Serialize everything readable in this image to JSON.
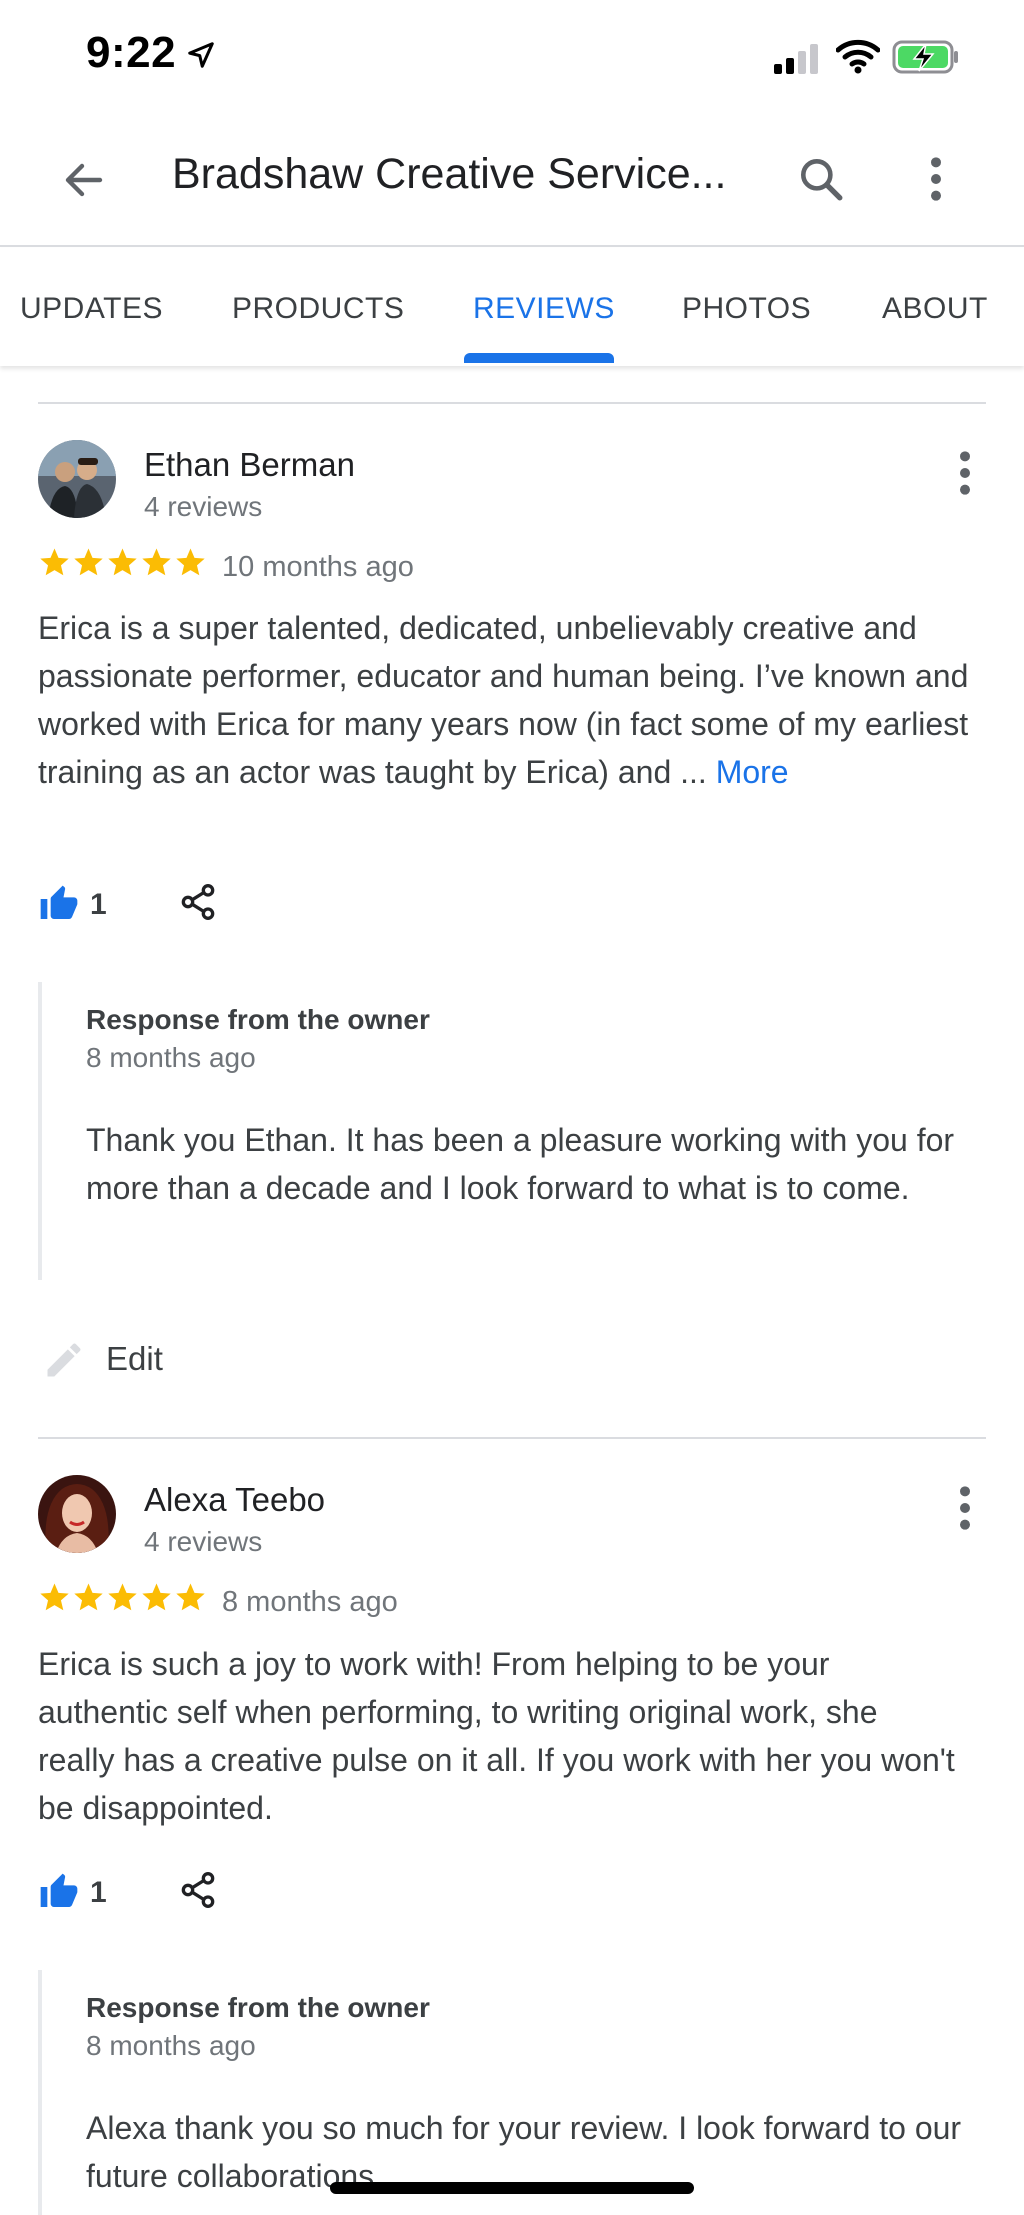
{
  "status_bar": {
    "time": "9:22",
    "icons": [
      "location-arrow-icon",
      "cellular-signal-icon",
      "wifi-icon",
      "battery-charging-icon"
    ],
    "battery_color": "#4cd964"
  },
  "app_bar": {
    "title": "Bradshaw Creative Service...",
    "icons": [
      "back-arrow-icon",
      "search-icon",
      "more-vert-icon"
    ]
  },
  "tabs": {
    "items": [
      {
        "label": "UPDATES"
      },
      {
        "label": "PRODUCTS"
      },
      {
        "label": "REVIEWS",
        "active": true
      },
      {
        "label": "PHOTOS"
      },
      {
        "label": "ABOUT"
      }
    ],
    "accent_color": "#1a73e8"
  },
  "reviews": [
    {
      "name": "Ethan Berman",
      "review_count": "4 reviews",
      "rating": 5,
      "date": "10 months ago",
      "text": "Erica is a super talented, dedicated, unbelievably creative and passionate performer, educator and human being. I’ve known and worked with Erica for many years now (in fact some of my earliest training as an actor was taught by Erica) and ...",
      "more_label": "More",
      "likes": "1",
      "owner_response": {
        "label": "Response from the owner",
        "date": "8 months ago",
        "text": "Thank you Ethan. It has been a pleasure working with you for more than a decade and I look forward to what is to come."
      },
      "edit_label": "Edit"
    },
    {
      "name": "Alexa Teebo",
      "review_count": "4 reviews",
      "rating": 5,
      "date": "8 months ago",
      "text": "Erica is such a joy to work with! From helping to be your authentic self when performing, to writing original work, she really has a creative pulse on it all. If you work with her you won't be disappointed.",
      "likes": "1",
      "owner_response": {
        "label": "Response from the owner",
        "date": "8 months ago",
        "text": "Alexa thank you so much for your review. I look forward to our future collaborations."
      }
    }
  ],
  "colors": {
    "star": "#fbbc04",
    "link": "#1a73e8",
    "secondary_text": "#70757a"
  }
}
